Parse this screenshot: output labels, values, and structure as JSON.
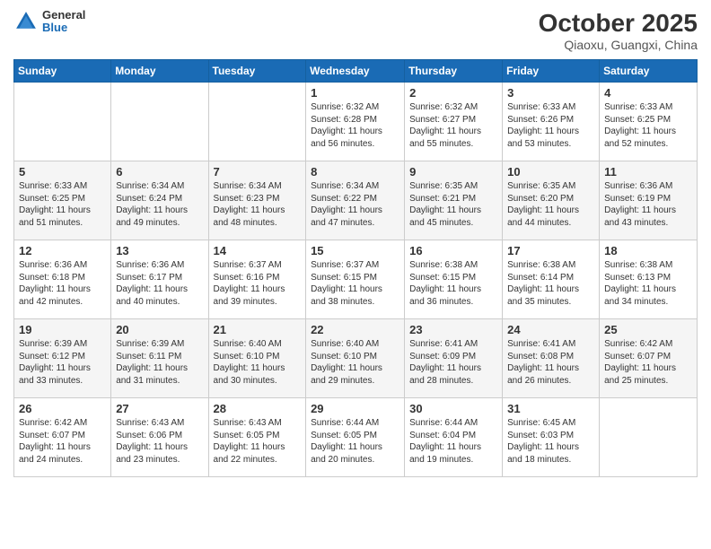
{
  "header": {
    "logo_line1": "General",
    "logo_line2": "Blue",
    "title": "October 2025",
    "subtitle": "Qiaoxu, Guangxi, China"
  },
  "weekdays": [
    "Sunday",
    "Monday",
    "Tuesday",
    "Wednesday",
    "Thursday",
    "Friday",
    "Saturday"
  ],
  "weeks": [
    [
      {
        "day": "",
        "sunrise": "",
        "sunset": "",
        "daylight": ""
      },
      {
        "day": "",
        "sunrise": "",
        "sunset": "",
        "daylight": ""
      },
      {
        "day": "",
        "sunrise": "",
        "sunset": "",
        "daylight": ""
      },
      {
        "day": "1",
        "sunrise": "Sunrise: 6:32 AM",
        "sunset": "Sunset: 6:28 PM",
        "daylight": "Daylight: 11 hours and 56 minutes."
      },
      {
        "day": "2",
        "sunrise": "Sunrise: 6:32 AM",
        "sunset": "Sunset: 6:27 PM",
        "daylight": "Daylight: 11 hours and 55 minutes."
      },
      {
        "day": "3",
        "sunrise": "Sunrise: 6:33 AM",
        "sunset": "Sunset: 6:26 PM",
        "daylight": "Daylight: 11 hours and 53 minutes."
      },
      {
        "day": "4",
        "sunrise": "Sunrise: 6:33 AM",
        "sunset": "Sunset: 6:25 PM",
        "daylight": "Daylight: 11 hours and 52 minutes."
      }
    ],
    [
      {
        "day": "5",
        "sunrise": "Sunrise: 6:33 AM",
        "sunset": "Sunset: 6:25 PM",
        "daylight": "Daylight: 11 hours and 51 minutes."
      },
      {
        "day": "6",
        "sunrise": "Sunrise: 6:34 AM",
        "sunset": "Sunset: 6:24 PM",
        "daylight": "Daylight: 11 hours and 49 minutes."
      },
      {
        "day": "7",
        "sunrise": "Sunrise: 6:34 AM",
        "sunset": "Sunset: 6:23 PM",
        "daylight": "Daylight: 11 hours and 48 minutes."
      },
      {
        "day": "8",
        "sunrise": "Sunrise: 6:34 AM",
        "sunset": "Sunset: 6:22 PM",
        "daylight": "Daylight: 11 hours and 47 minutes."
      },
      {
        "day": "9",
        "sunrise": "Sunrise: 6:35 AM",
        "sunset": "Sunset: 6:21 PM",
        "daylight": "Daylight: 11 hours and 45 minutes."
      },
      {
        "day": "10",
        "sunrise": "Sunrise: 6:35 AM",
        "sunset": "Sunset: 6:20 PM",
        "daylight": "Daylight: 11 hours and 44 minutes."
      },
      {
        "day": "11",
        "sunrise": "Sunrise: 6:36 AM",
        "sunset": "Sunset: 6:19 PM",
        "daylight": "Daylight: 11 hours and 43 minutes."
      }
    ],
    [
      {
        "day": "12",
        "sunrise": "Sunrise: 6:36 AM",
        "sunset": "Sunset: 6:18 PM",
        "daylight": "Daylight: 11 hours and 42 minutes."
      },
      {
        "day": "13",
        "sunrise": "Sunrise: 6:36 AM",
        "sunset": "Sunset: 6:17 PM",
        "daylight": "Daylight: 11 hours and 40 minutes."
      },
      {
        "day": "14",
        "sunrise": "Sunrise: 6:37 AM",
        "sunset": "Sunset: 6:16 PM",
        "daylight": "Daylight: 11 hours and 39 minutes."
      },
      {
        "day": "15",
        "sunrise": "Sunrise: 6:37 AM",
        "sunset": "Sunset: 6:15 PM",
        "daylight": "Daylight: 11 hours and 38 minutes."
      },
      {
        "day": "16",
        "sunrise": "Sunrise: 6:38 AM",
        "sunset": "Sunset: 6:15 PM",
        "daylight": "Daylight: 11 hours and 36 minutes."
      },
      {
        "day": "17",
        "sunrise": "Sunrise: 6:38 AM",
        "sunset": "Sunset: 6:14 PM",
        "daylight": "Daylight: 11 hours and 35 minutes."
      },
      {
        "day": "18",
        "sunrise": "Sunrise: 6:38 AM",
        "sunset": "Sunset: 6:13 PM",
        "daylight": "Daylight: 11 hours and 34 minutes."
      }
    ],
    [
      {
        "day": "19",
        "sunrise": "Sunrise: 6:39 AM",
        "sunset": "Sunset: 6:12 PM",
        "daylight": "Daylight: 11 hours and 33 minutes."
      },
      {
        "day": "20",
        "sunrise": "Sunrise: 6:39 AM",
        "sunset": "Sunset: 6:11 PM",
        "daylight": "Daylight: 11 hours and 31 minutes."
      },
      {
        "day": "21",
        "sunrise": "Sunrise: 6:40 AM",
        "sunset": "Sunset: 6:10 PM",
        "daylight": "Daylight: 11 hours and 30 minutes."
      },
      {
        "day": "22",
        "sunrise": "Sunrise: 6:40 AM",
        "sunset": "Sunset: 6:10 PM",
        "daylight": "Daylight: 11 hours and 29 minutes."
      },
      {
        "day": "23",
        "sunrise": "Sunrise: 6:41 AM",
        "sunset": "Sunset: 6:09 PM",
        "daylight": "Daylight: 11 hours and 28 minutes."
      },
      {
        "day": "24",
        "sunrise": "Sunrise: 6:41 AM",
        "sunset": "Sunset: 6:08 PM",
        "daylight": "Daylight: 11 hours and 26 minutes."
      },
      {
        "day": "25",
        "sunrise": "Sunrise: 6:42 AM",
        "sunset": "Sunset: 6:07 PM",
        "daylight": "Daylight: 11 hours and 25 minutes."
      }
    ],
    [
      {
        "day": "26",
        "sunrise": "Sunrise: 6:42 AM",
        "sunset": "Sunset: 6:07 PM",
        "daylight": "Daylight: 11 hours and 24 minutes."
      },
      {
        "day": "27",
        "sunrise": "Sunrise: 6:43 AM",
        "sunset": "Sunset: 6:06 PM",
        "daylight": "Daylight: 11 hours and 23 minutes."
      },
      {
        "day": "28",
        "sunrise": "Sunrise: 6:43 AM",
        "sunset": "Sunset: 6:05 PM",
        "daylight": "Daylight: 11 hours and 22 minutes."
      },
      {
        "day": "29",
        "sunrise": "Sunrise: 6:44 AM",
        "sunset": "Sunset: 6:05 PM",
        "daylight": "Daylight: 11 hours and 20 minutes."
      },
      {
        "day": "30",
        "sunrise": "Sunrise: 6:44 AM",
        "sunset": "Sunset: 6:04 PM",
        "daylight": "Daylight: 11 hours and 19 minutes."
      },
      {
        "day": "31",
        "sunrise": "Sunrise: 6:45 AM",
        "sunset": "Sunset: 6:03 PM",
        "daylight": "Daylight: 11 hours and 18 minutes."
      },
      {
        "day": "",
        "sunrise": "",
        "sunset": "",
        "daylight": ""
      }
    ]
  ]
}
